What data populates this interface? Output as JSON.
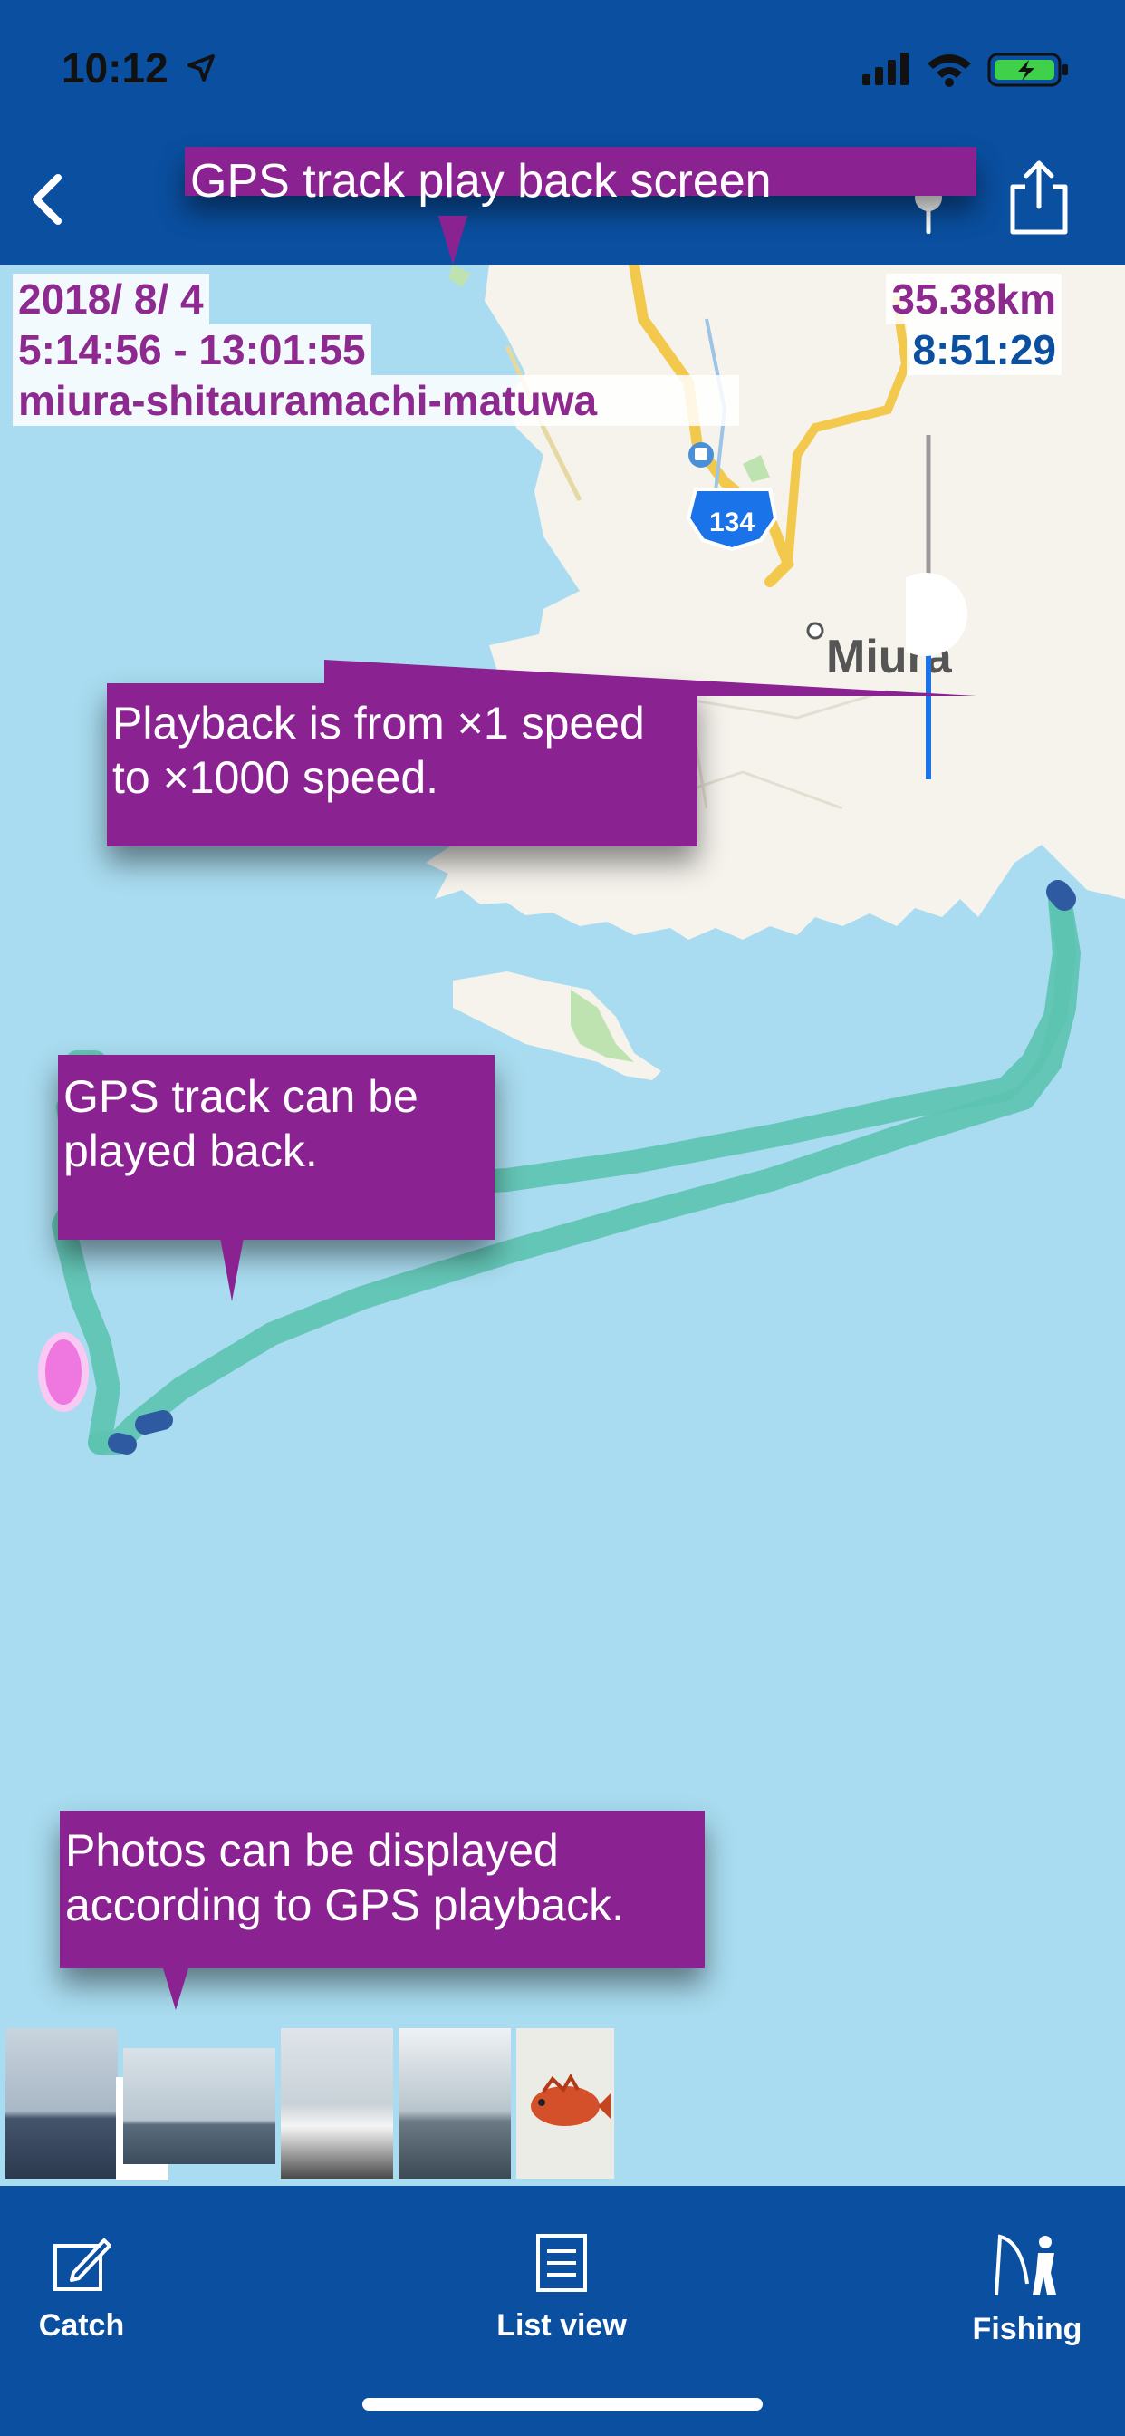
{
  "status_bar": {
    "time": "10:12",
    "icons": [
      "location-arrow-icon",
      "cellular-signal-icon",
      "wifi-icon",
      "battery-charging-icon"
    ]
  },
  "nav": {
    "back_icon": "chevron-left-icon",
    "playback_slider_icon": "slider-pin-icon",
    "share_icon": "share-icon"
  },
  "track_info": {
    "date": "2018/ 8/ 4",
    "time_range": "5:14:56  - 13:01:55",
    "location": "miura-shitauramachi-matuwa",
    "distance": "35.38km",
    "duration": "8:51:29"
  },
  "map": {
    "place_label": "Miura",
    "route_number": "134"
  },
  "callouts": {
    "title": "GPS track play back screen",
    "speed": "Playback is from ×1 speed to ×1000 speed.",
    "track": "GPS track can be played back.",
    "photos": "Photos can be displayed according to GPS playback."
  },
  "tabs": {
    "catch": "Catch",
    "list_view": "List view",
    "fishing": "Fishing"
  },
  "colors": {
    "nav_blue": "#0a4fa0",
    "callout_purple": "#8b2291",
    "track_teal": "#5cc3b0",
    "sea": "#a9dcf0",
    "land": "#f6f3ed"
  }
}
